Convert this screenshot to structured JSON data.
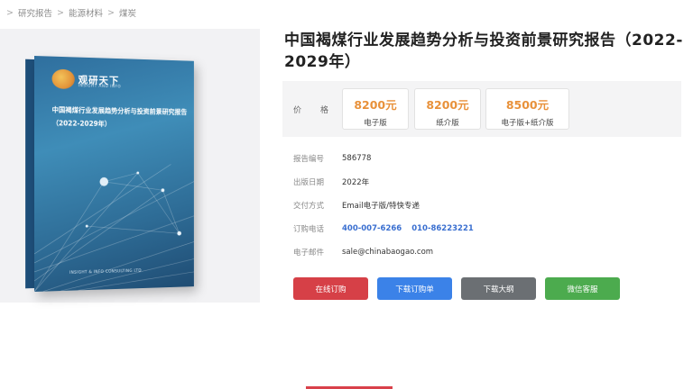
{
  "breadcrumb": {
    "separator": ">",
    "items": [
      "研究报告",
      "能源材料",
      "煤炭"
    ]
  },
  "cover": {
    "logo_text": "观研天下",
    "logo_sub": "INSIGHT AND INFO",
    "title": "中国褐煤行业发展趋势分析与投资前景研究报告（2022-2029年）",
    "side_text": "观研天下",
    "footer": "INSIGHT & INFO CONSULTING LTD"
  },
  "report": {
    "title": "中国褐煤行业发展趋势分析与投资前景研究报告（2022-2029年）"
  },
  "price": {
    "label": "价　格",
    "options": [
      {
        "amount": "8200元",
        "kind": "电子版"
      },
      {
        "amount": "8200元",
        "kind": "纸介版"
      },
      {
        "amount": "8500元",
        "kind": "电子版+纸介版"
      }
    ]
  },
  "info": {
    "report_no_label": "报告编号",
    "report_no": "586778",
    "date_label": "出版日期",
    "date": "2022年",
    "delivery_label": "交付方式",
    "delivery": "Email电子版/特快专递",
    "phone_label": "订购电话",
    "phone1": "400-007-6266",
    "phone2": "010-86223221",
    "email_label": "电子邮件",
    "email": "sale@chinabaogao.com"
  },
  "buttons": {
    "order_online": "在线订购",
    "download_form": "下载订购单",
    "download_outline": "下载大纲",
    "wechat_service": "微信客服"
  },
  "colors": {
    "order_online": "#d64047",
    "download_form": "#3b82e8",
    "download_outline": "#6b6f73",
    "wechat_service": "#4cab4e",
    "price_accent": "#e8913a",
    "phone_accent": "#3a6fd0"
  }
}
